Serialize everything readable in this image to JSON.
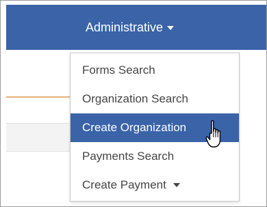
{
  "navbar": {
    "administrative_label": "Administrative"
  },
  "dropdown": {
    "items": [
      {
        "label": "Forms Search"
      },
      {
        "label": "Organization Search"
      },
      {
        "label": "Create Organization"
      },
      {
        "label": "Payments Search"
      },
      {
        "label": "Create Payment"
      }
    ]
  },
  "colors": {
    "accent": "#3a63a8",
    "menu_text": "#444444",
    "orange_rule": "#e8b178"
  },
  "icons": {
    "cursor": "hand-pointer-icon",
    "nav_caret": "caret-down-icon",
    "submenu_caret": "caret-down-icon"
  }
}
